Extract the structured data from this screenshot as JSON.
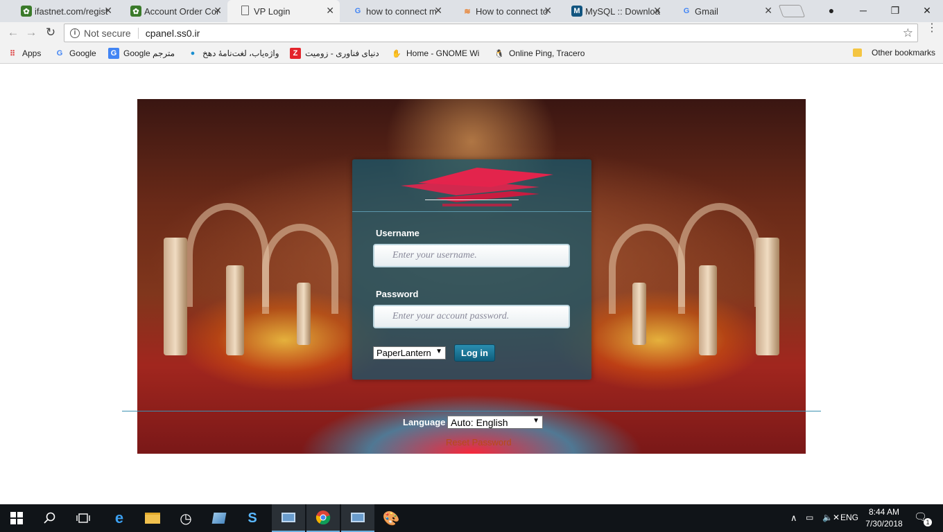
{
  "browser": {
    "tabs": [
      {
        "title": "ifastnet.com/regist",
        "icon": "ifastnet-favicon",
        "active": false
      },
      {
        "title": "Account Order Cor",
        "icon": "ifastnet-favicon",
        "active": false
      },
      {
        "title": "VP Login",
        "icon": "document-icon",
        "active": true
      },
      {
        "title": "how to connect m",
        "icon": "google-icon",
        "active": false
      },
      {
        "title": "How to connect to",
        "icon": "stackoverflow-icon",
        "active": false
      },
      {
        "title": "MySQL :: Downloa",
        "icon": "mysql-icon",
        "active": false
      },
      {
        "title": "Gmail",
        "icon": "google-icon",
        "active": false
      }
    ],
    "address": {
      "security_label": "Not secure",
      "url": "cpanel.ss0.ir"
    },
    "bookmarks": [
      {
        "label": "Apps",
        "icon": "apps-grid-icon"
      },
      {
        "label": "Google",
        "icon": "google-icon"
      },
      {
        "label": "Google مترجم",
        "icon": "google-translate-icon"
      },
      {
        "label": "واژه‌یاب، لغت‌نامهٔ دهخ",
        "icon": "map-pin-icon"
      },
      {
        "label": "دنیای فناوری - زومیت",
        "icon": "zoomit-icon"
      },
      {
        "label": "Home - GNOME Wi",
        "icon": "gnome-icon"
      },
      {
        "label": "Online Ping, Tracero",
        "icon": "tux-icon"
      }
    ],
    "other_bookmarks": "Other bookmarks"
  },
  "login": {
    "username_label": "Username",
    "username_placeholder": "Enter your username.",
    "password_label": "Password",
    "password_placeholder": "Enter your account password.",
    "theme_value": "PaperLantern",
    "login_button": "Log in",
    "language_label": "Language",
    "language_value": "Auto: English",
    "reset_link": "Reset Password"
  },
  "taskbar": {
    "language": "ENG",
    "time": "8:44 AM",
    "date": "7/30/2018",
    "notifications": "1"
  },
  "colors": {
    "panel": "#10586e",
    "login_button": "#1a7596",
    "logo_red": "#e3244c"
  }
}
